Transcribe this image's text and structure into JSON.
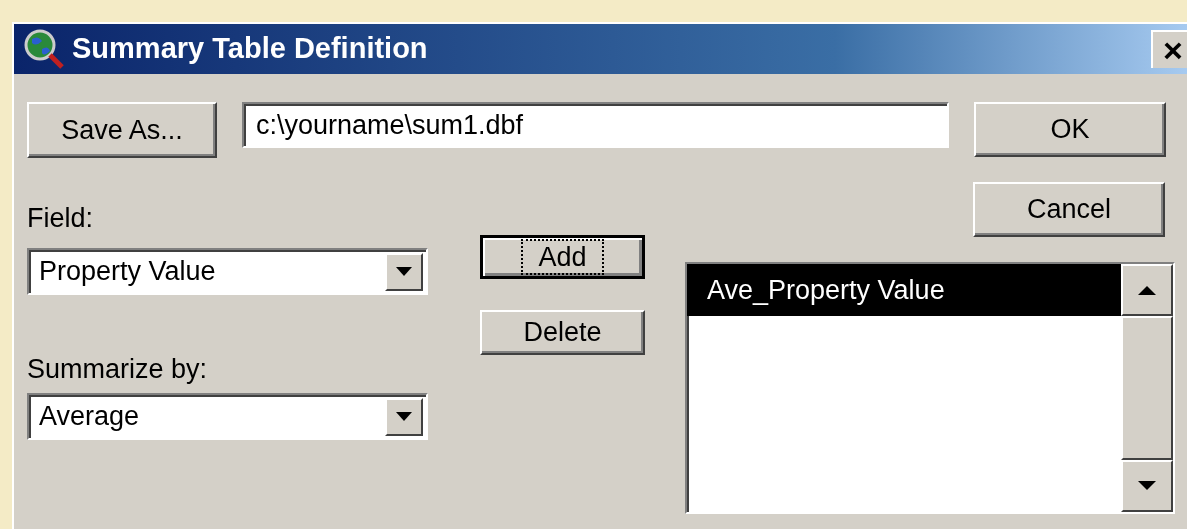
{
  "window": {
    "title": "Summary Table Definition",
    "close": "×"
  },
  "save_as_button": "Save As...",
  "output_file": {
    "value": "c:\\yourname\\sum1.dbf"
  },
  "ok_button": "OK",
  "cancel_button": "Cancel",
  "field": {
    "label": "Field:",
    "value": "Property Value"
  },
  "summarize_by": {
    "label": "Summarize by:",
    "value": "Average"
  },
  "add_button": {
    "label": "Add",
    "focused": true
  },
  "delete_button": {
    "label": "Delete",
    "focused": false
  },
  "summary_list": {
    "items": [
      {
        "label": "Ave_Property Value",
        "selected": true
      }
    ]
  }
}
